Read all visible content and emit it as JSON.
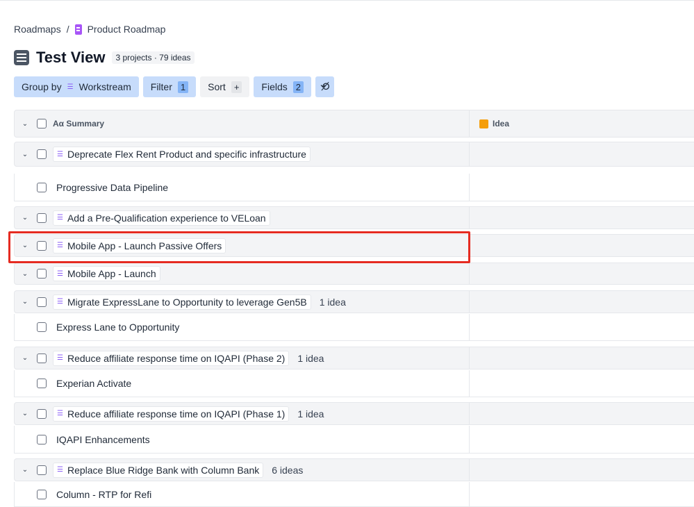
{
  "breadcrumb": {
    "root": "Roadmaps",
    "sep": "/",
    "current": "Product Roadmap"
  },
  "title": "Test View",
  "count": "3 projects · 79 ideas",
  "toolbar": {
    "group_by": "Group by",
    "group_value": "Workstream",
    "filter": "Filter",
    "filter_count": "1",
    "sort": "Sort",
    "sort_add": "+",
    "fields": "Fields",
    "fields_count": "2"
  },
  "columns": {
    "summary": "Summary",
    "summary_prefix": "Aα",
    "idea": "Idea"
  },
  "rows": [
    {
      "type": "group",
      "label": "Deprecate Flex Rent Product and specific infrastructure",
      "ideas": ""
    },
    {
      "type": "item",
      "label": "Progressive Data Pipeline"
    },
    {
      "type": "group",
      "label": "Add a Pre-Qualification experience to VELoan",
      "ideas": ""
    },
    {
      "type": "group",
      "label": "Mobile App - Launch Passive Offers",
      "ideas": "",
      "highlighted": true
    },
    {
      "type": "group",
      "label": "Mobile App - Launch",
      "ideas": ""
    },
    {
      "type": "group",
      "label": "Migrate ExpressLane to Opportunity to leverage Gen5B",
      "ideas": "1 idea"
    },
    {
      "type": "item",
      "label": "Express Lane to Opportunity"
    },
    {
      "type": "group",
      "label": "Reduce affiliate response time on IQAPI (Phase 2)",
      "ideas": "1 idea"
    },
    {
      "type": "item",
      "label": "Experian Activate"
    },
    {
      "type": "group",
      "label": "Reduce affiliate response time on IQAPI (Phase 1)",
      "ideas": "1 idea"
    },
    {
      "type": "item",
      "label": "IQAPI Enhancements"
    },
    {
      "type": "group",
      "label": "Replace Blue Ridge Bank with Column Bank",
      "ideas": "6 ideas"
    },
    {
      "type": "item",
      "label": "Column - RTP for Refi"
    }
  ],
  "colors": {
    "highlight": "#e52b21",
    "toolbar": "#c7dcfb"
  }
}
